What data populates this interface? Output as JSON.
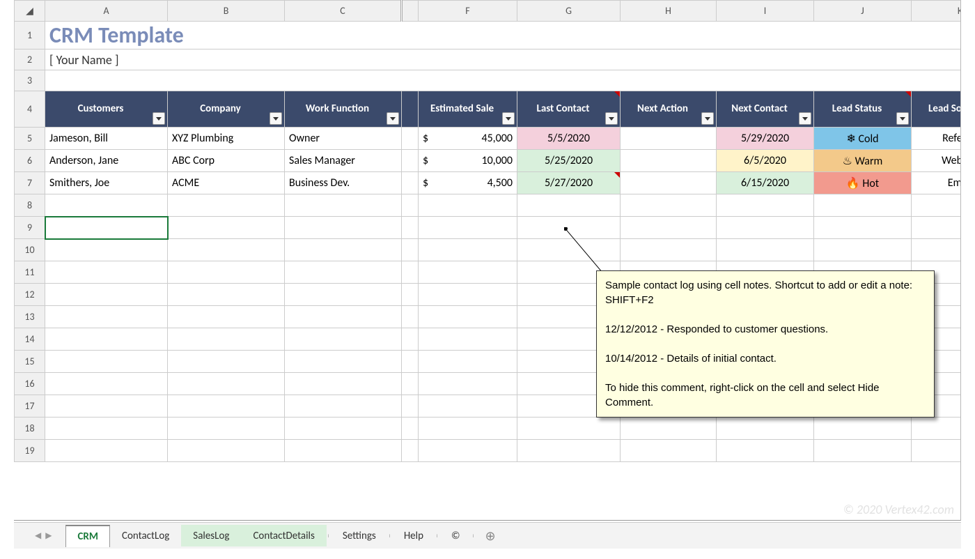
{
  "title": "CRM Template",
  "subtitle": "[ Your Name ]",
  "visibleColumns": [
    "A",
    "B",
    "C",
    "F",
    "G",
    "H",
    "I",
    "J",
    "K"
  ],
  "visibleRows": [
    1,
    2,
    3,
    4,
    5,
    6,
    7,
    8,
    9,
    10,
    11,
    12,
    13,
    14,
    15,
    16,
    17,
    18,
    19
  ],
  "selectedRow": 9,
  "headers": {
    "customers": "Customers",
    "company": "Company",
    "work_function": "Work Function",
    "estimated_sale": "Estimated Sale",
    "last_contact": "Last Contact",
    "next_action": "Next Action",
    "next_contact": "Next Contact",
    "lead_status": "Lead Status",
    "lead_source": "Lead Source"
  },
  "currency_symbol": "$",
  "data": [
    {
      "row": 5,
      "customer": "Jameson, Bill",
      "company": "XYZ Plumbing",
      "function": "Owner",
      "sale": "45,000",
      "last_contact": "5/5/2020",
      "last_color": "pink",
      "next_action": "",
      "next_contact": "5/29/2020",
      "next_color": "pink",
      "status": "Cold",
      "status_icon": "❄",
      "status_class": "cold",
      "source": "Referral"
    },
    {
      "row": 6,
      "customer": "Anderson, Jane",
      "company": "ABC Corp",
      "function": "Sales Manager",
      "sale": "10,000",
      "last_contact": "5/25/2020",
      "last_color": "mint",
      "next_action": "",
      "next_contact": "6/5/2020",
      "next_color": "lemon",
      "status": "Warm",
      "status_icon": "♨",
      "status_class": "warm",
      "source": "Website"
    },
    {
      "row": 7,
      "customer": "Smithers, Joe",
      "company": "ACME",
      "function": "Business Dev.",
      "sale": "4,500",
      "last_contact": "5/27/2020",
      "last_color": "mint",
      "next_action": "",
      "next_contact": "6/15/2020",
      "next_color": "mint",
      "status": "Hot",
      "status_icon": "🔥",
      "status_class": "hot",
      "source": "Email",
      "has_note": true
    }
  ],
  "comment": {
    "line1": "Sample contact log using cell notes. Shortcut to add or edit a note: SHIFT+F2",
    "line2": "12/12/2012 - Responded to customer questions.",
    "line3": "10/14/2012 - Details of initial contact.",
    "line4": "To hide this comment, right-click on the cell and select Hide Comment."
  },
  "tabs": [
    {
      "label": "CRM",
      "active": true
    },
    {
      "label": "ContactLog",
      "green": false
    },
    {
      "label": "SalesLog",
      "green": true
    },
    {
      "label": "ContactDetails",
      "green": true
    },
    {
      "label": "Settings"
    },
    {
      "label": "Help"
    },
    {
      "label": "©"
    }
  ],
  "watermark": "© 2020 Vertex42.com"
}
